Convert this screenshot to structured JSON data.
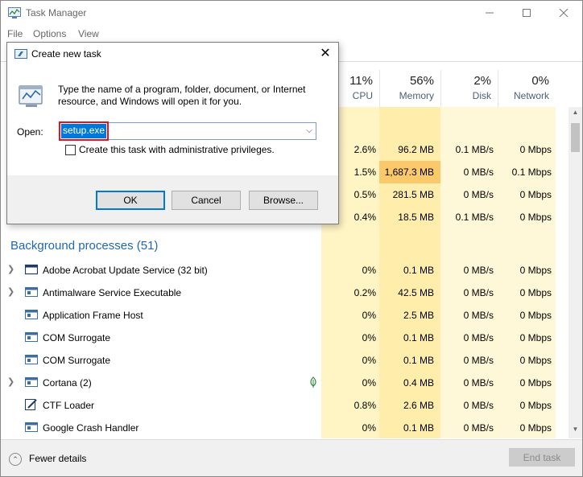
{
  "window": {
    "title": "Task Manager",
    "minimize_glyph": "—",
    "maximize_glyph": "☐",
    "close_glyph": "✕"
  },
  "menu": [
    "File",
    "Options",
    "View"
  ],
  "columns": [
    {
      "pct": "11%",
      "name": "CPU"
    },
    {
      "pct": "56%",
      "name": "Memory"
    },
    {
      "pct": "2%",
      "name": "Disk"
    },
    {
      "pct": "0%",
      "name": "Network"
    }
  ],
  "app_rows": [
    {
      "cpu": "2.6%",
      "memory": "96.2 MB",
      "disk": "0.1 MB/s",
      "network": "0 Mbps"
    },
    {
      "cpu": "1.5%",
      "memory": "1,687.3 MB",
      "disk": "0 MB/s",
      "network": "0.1 Mbps",
      "memory_hot": true
    },
    {
      "cpu": "0.5%",
      "memory": "281.5 MB",
      "disk": "0 MB/s",
      "network": "0 Mbps"
    },
    {
      "cpu": "0.4%",
      "memory": "18.5 MB",
      "disk": "0.1 MB/s",
      "network": "0 Mbps"
    }
  ],
  "background_group": "Background processes (51)",
  "background_rows": [
    {
      "name": "Adobe Acrobat Update Service (32 bit)",
      "expand": true,
      "cpu": "0%",
      "memory": "0.1 MB",
      "disk": "0 MB/s",
      "network": "0 Mbps"
    },
    {
      "name": "Antimalware Service Executable",
      "expand": true,
      "cpu": "0.2%",
      "memory": "42.5 MB",
      "disk": "0 MB/s",
      "network": "0 Mbps"
    },
    {
      "name": "Application Frame Host",
      "expand": false,
      "cpu": "0%",
      "memory": "2.5 MB",
      "disk": "0 MB/s",
      "network": "0 Mbps"
    },
    {
      "name": "COM Surrogate",
      "expand": false,
      "cpu": "0%",
      "memory": "0.1 MB",
      "disk": "0 MB/s",
      "network": "0 Mbps"
    },
    {
      "name": "COM Surrogate",
      "expand": false,
      "cpu": "0%",
      "memory": "0.1 MB",
      "disk": "0 MB/s",
      "network": "0 Mbps"
    },
    {
      "name": "Cortana (2)",
      "expand": true,
      "suspended_leaf": true,
      "cpu": "0%",
      "memory": "0.4 MB",
      "disk": "0 MB/s",
      "network": "0 Mbps"
    },
    {
      "name": "CTF Loader",
      "expand": false,
      "cpu": "0.8%",
      "memory": "2.6 MB",
      "disk": "0 MB/s",
      "network": "0 Mbps"
    },
    {
      "name": "Google Crash Handler",
      "expand": false,
      "cpu": "0%",
      "memory": "0.1 MB",
      "disk": "0 MB/s",
      "network": "0 Mbps"
    }
  ],
  "footer": {
    "fewer_details": "Fewer details",
    "end_task": "End task"
  },
  "dialog": {
    "title": "Create new task",
    "description": "Type the name of a program, folder, document, or Internet resource, and Windows will open it for you.",
    "open_label": "Open:",
    "open_value": "setup.exe",
    "admin_checkbox_label": "Create this task with administrative privileges.",
    "admin_checked": false,
    "ok": "OK",
    "cancel": "Cancel",
    "browse": "Browse..."
  },
  "colors": {
    "cpu_bg": "#fff4c4",
    "memory_bg": "#ffeeab",
    "light_bg": "#fff8d8",
    "hot": "#f9c96c",
    "accent": "#0078d7",
    "group_text": "#2067b2"
  }
}
